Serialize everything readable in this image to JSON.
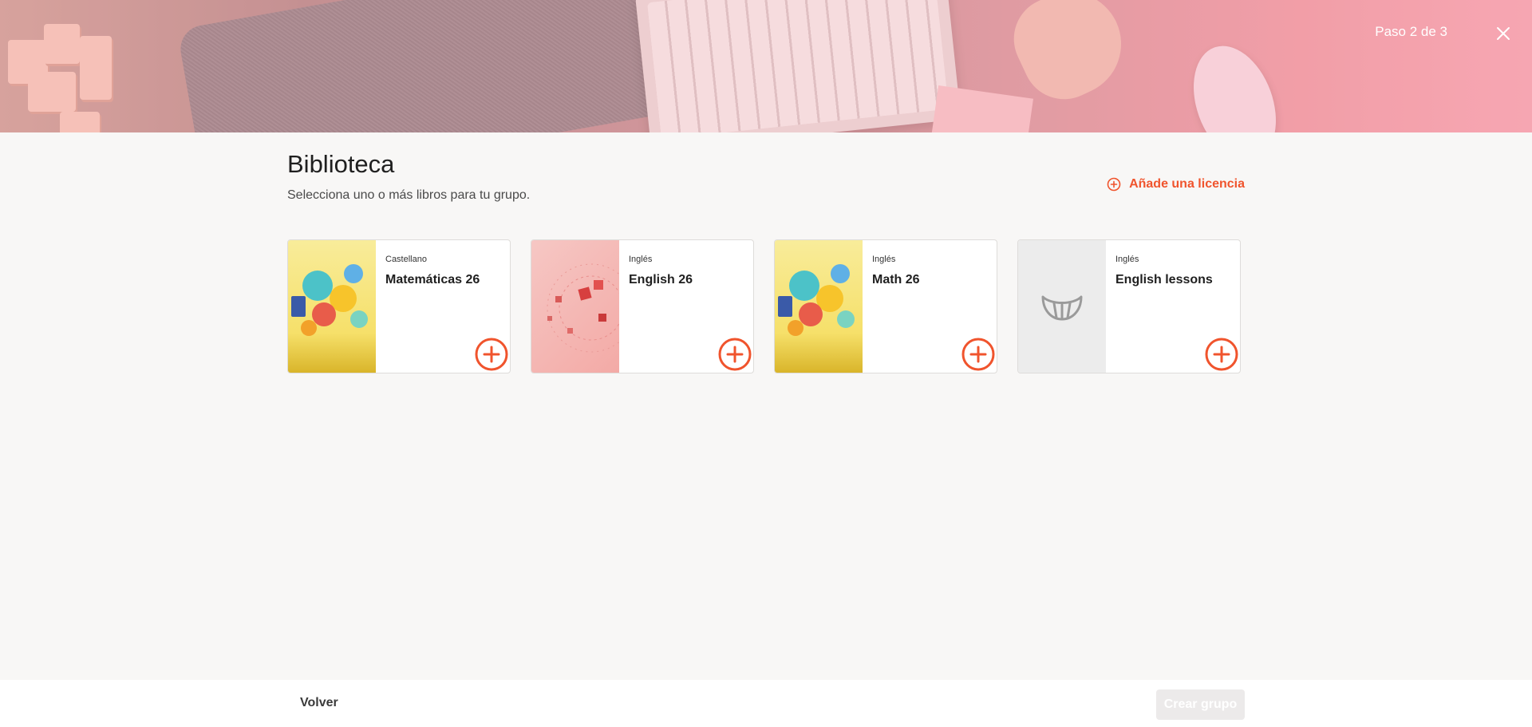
{
  "header": {
    "step": "Paso 2 de 3",
    "close_icon": "close-icon"
  },
  "main": {
    "title": "Biblioteca",
    "subtitle": "Selecciona uno o más libros para tu grupo.",
    "add_license": "Añade una licencia",
    "add_license_icon": "plus-circle-icon"
  },
  "books": [
    {
      "language": "Castellano",
      "title": "Matemáticas 26",
      "cover": "math-cover"
    },
    {
      "language": "Inglés",
      "title": "English 26",
      "cover": "english-cover"
    },
    {
      "language": "Inglés",
      "title": "Math 26",
      "cover": "math-cover"
    },
    {
      "language": "Inglés",
      "title": "English lessons",
      "cover": "placeholder-cover"
    }
  ],
  "footer": {
    "back": "Volver",
    "create": "Crear grupo"
  },
  "colors": {
    "accent": "#f0542d",
    "disabled": "#eceaea",
    "background": "#f8f7f6"
  }
}
